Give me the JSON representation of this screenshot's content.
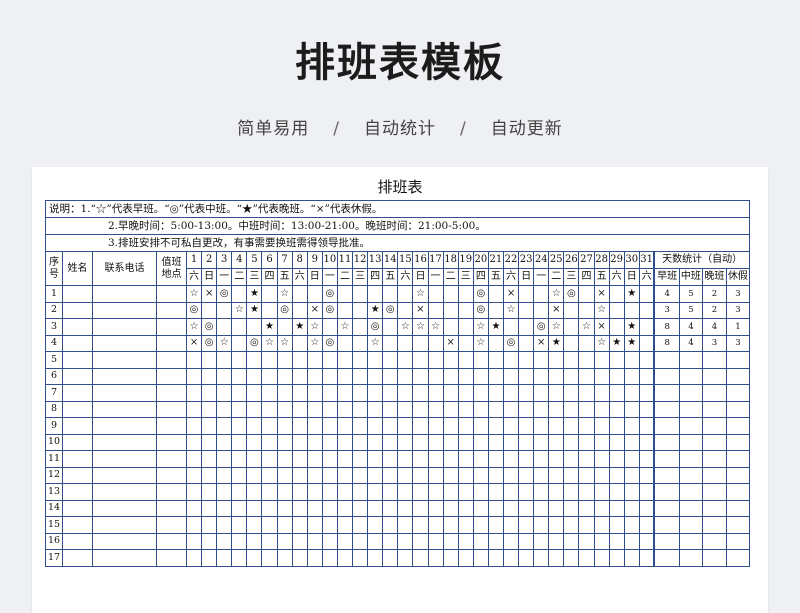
{
  "header": {
    "title": "排班表模板",
    "subtitle_items": [
      "简单易用",
      "自动统计",
      "自动更新"
    ],
    "separator": "/"
  },
  "sheet": {
    "title": "排班表",
    "notes": [
      "说明：1.“☆”代表早班。“◎”代表中班。“★”代表晚班。“×”代表休假。",
      "2.早晚时间：5:00-13:00。中班时间：13:00-21:00。晚班时间：21:00-5:00。",
      "3.排班安排不可私自更改，有事需要换班需得领导批准。"
    ],
    "columns": {
      "seq": "序号",
      "name": "姓名",
      "phone": "联系电话",
      "location": "值班地点",
      "stats_title": "天数统计（自动）",
      "stats": [
        "早班",
        "中班",
        "晚班",
        "休假"
      ]
    },
    "days": [
      "1",
      "2",
      "3",
      "4",
      "5",
      "6",
      "7",
      "8",
      "9",
      "10",
      "11",
      "12",
      "13",
      "14",
      "15",
      "16",
      "17",
      "18",
      "19",
      "20",
      "21",
      "22",
      "23",
      "24",
      "25",
      "26",
      "27",
      "28",
      "29",
      "30",
      "31"
    ],
    "weekdays": [
      "六",
      "日",
      "一",
      "二",
      "三",
      "四",
      "五",
      "六",
      "日",
      "一",
      "二",
      "三",
      "四",
      "五",
      "六",
      "日",
      "一",
      "二",
      "三",
      "四",
      "五",
      "六",
      "日",
      "一",
      "二",
      "三",
      "四",
      "五",
      "六",
      "日",
      "六"
    ],
    "rows": [
      {
        "no": "1",
        "marks": [
          "☆",
          "×",
          "◎",
          "",
          "★",
          "",
          "☆",
          "",
          "",
          "◎",
          "",
          "",
          "",
          "",
          "",
          "☆",
          "",
          "",
          "",
          "◎",
          "",
          "×",
          "",
          "",
          "☆",
          "◎",
          "",
          "×",
          "",
          "★",
          ""
        ],
        "stats": [
          "4",
          "5",
          "2",
          "3"
        ]
      },
      {
        "no": "2",
        "marks": [
          "◎",
          "",
          "",
          "☆",
          "★",
          "",
          "◎",
          "",
          "×",
          "◎",
          "",
          "",
          "★",
          "◎",
          "",
          "×",
          "",
          "",
          "",
          "◎",
          "",
          "☆",
          "",
          "",
          "×",
          "",
          "",
          "☆",
          "",
          "",
          ""
        ],
        "stats": [
          "3",
          "5",
          "2",
          "3"
        ]
      },
      {
        "no": "3",
        "marks": [
          "☆",
          "◎",
          "",
          "",
          "",
          "★",
          "",
          "★",
          "☆",
          "",
          "☆",
          "",
          "◎",
          "",
          "☆",
          "☆",
          "☆",
          "",
          "",
          "☆",
          "★",
          "",
          "",
          "◎",
          "☆",
          "",
          "☆",
          "×",
          "",
          "★",
          ""
        ],
        "stats": [
          "8",
          "4",
          "4",
          "1"
        ]
      },
      {
        "no": "4",
        "marks": [
          "×",
          "◎",
          "☆",
          "",
          "◎",
          "☆",
          "☆",
          "",
          "☆",
          "◎",
          "",
          "",
          "☆",
          "",
          "",
          "",
          "",
          "×",
          "",
          "☆",
          "",
          "◎",
          "",
          "×",
          "★",
          "",
          "",
          "☆",
          "★",
          "★",
          ""
        ],
        "stats": [
          "8",
          "4",
          "3",
          "3"
        ]
      },
      {
        "no": "5",
        "marks": [],
        "stats": []
      },
      {
        "no": "6",
        "marks": [],
        "stats": []
      },
      {
        "no": "7",
        "marks": [],
        "stats": []
      },
      {
        "no": "8",
        "marks": [],
        "stats": []
      },
      {
        "no": "9",
        "marks": [],
        "stats": []
      },
      {
        "no": "10",
        "marks": [],
        "stats": []
      },
      {
        "no": "11",
        "marks": [],
        "stats": []
      },
      {
        "no": "12",
        "marks": [],
        "stats": []
      },
      {
        "no": "13",
        "marks": [],
        "stats": []
      },
      {
        "no": "14",
        "marks": [],
        "stats": []
      },
      {
        "no": "15",
        "marks": [],
        "stats": []
      },
      {
        "no": "16",
        "marks": [],
        "stats": []
      },
      {
        "no": "17",
        "marks": [],
        "stats": []
      }
    ]
  }
}
